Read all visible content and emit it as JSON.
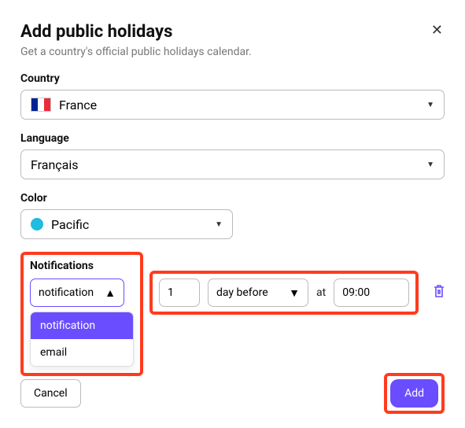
{
  "dialog": {
    "title": "Add public holidays",
    "subtitle": "Get a country's official public holidays calendar."
  },
  "country": {
    "label": "Country",
    "value": "France"
  },
  "language": {
    "label": "Language",
    "value": "Français"
  },
  "color": {
    "label": "Color",
    "value": "Pacific"
  },
  "notifications": {
    "label": "Notifications",
    "type_value": "notification",
    "amount": "1",
    "unit": "day before",
    "at_label": "at",
    "time": "09:00",
    "options": {
      "notification": "notification",
      "email": "email"
    }
  },
  "buttons": {
    "cancel": "Cancel",
    "add": "Add"
  }
}
